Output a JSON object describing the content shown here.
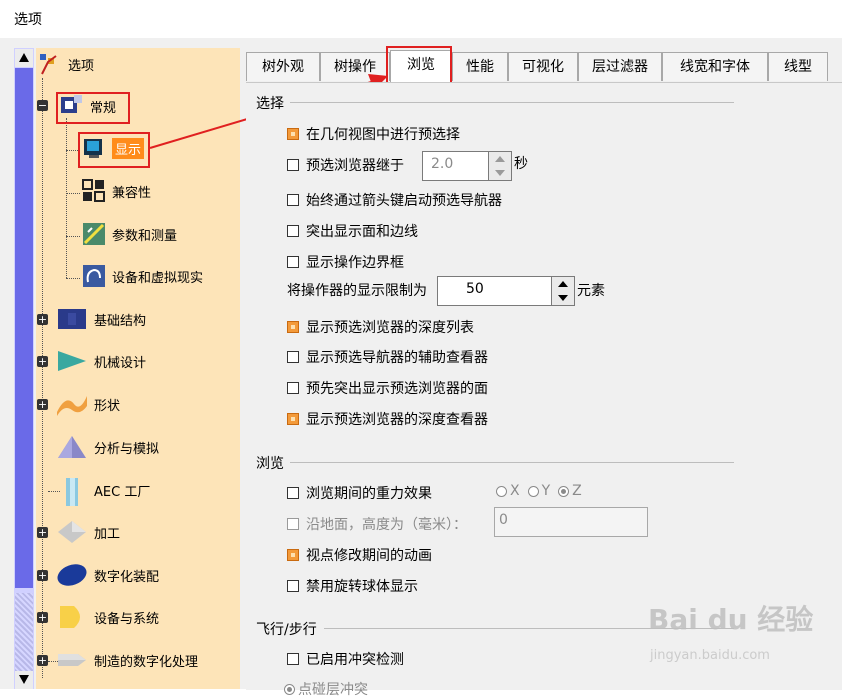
{
  "window": {
    "title": "选项"
  },
  "tree": {
    "root": "选项",
    "items": [
      {
        "label": "常规",
        "icon": "general-icon"
      },
      {
        "label": "显示",
        "icon": "display-icon",
        "selected": true
      },
      {
        "label": "兼容性",
        "icon": "compatibility-icon"
      },
      {
        "label": "参数和测量",
        "icon": "parameters-icon"
      },
      {
        "label": "设备和虚拟现实",
        "icon": "device-vr-icon"
      },
      {
        "label": "基础结构",
        "icon": "infrastructure-icon"
      },
      {
        "label": "机械设计",
        "icon": "mechanical-design-icon"
      },
      {
        "label": "形状",
        "icon": "shape-icon"
      },
      {
        "label": "分析与模拟",
        "icon": "analysis-icon"
      },
      {
        "label": "AEC 工厂",
        "icon": "aec-plant-icon"
      },
      {
        "label": "加工",
        "icon": "machining-icon"
      },
      {
        "label": "数字化装配",
        "icon": "digital-mockup-icon"
      },
      {
        "label": "设备与系统",
        "icon": "equipment-systems-icon"
      },
      {
        "label": "制造的数字化处理",
        "icon": "digital-manufacturing-icon"
      }
    ]
  },
  "tabs": [
    {
      "label": "树外观"
    },
    {
      "label": "树操作"
    },
    {
      "label": "浏览",
      "active": true
    },
    {
      "label": "性能"
    },
    {
      "label": "可视化"
    },
    {
      "label": "层过滤器"
    },
    {
      "label": "线宽和字体"
    },
    {
      "label": "线型"
    }
  ],
  "selection": {
    "heading": "选择",
    "preselect_geometry": "在几何视图中进行预选择",
    "preselect_navigator_label": "预选浏览器继于",
    "preselect_navigator_value": "2.0",
    "preselect_navigator_unit": "秒",
    "arrow_keys_navigator": "始终通过箭头键启动预选导航器",
    "highlight_faces_edges": "突出显示面和边线",
    "show_manipulator_bbox": "显示操作边界框",
    "manipulator_limit_label": "将操作器的显示限制为",
    "manipulator_limit_value": "50",
    "manipulator_limit_unit": "元素",
    "show_depth_list": "显示预选浏览器的深度列表",
    "show_aux_viewer": "显示预选导航器的辅助查看器",
    "prehighlight_faces": "预先突出显示预选浏览器的面",
    "show_depth_viewer": "显示预选浏览器的深度查看器"
  },
  "navigation": {
    "heading": "浏览",
    "gravity_effect": "浏览期间的重力效果",
    "axis_x": "X",
    "axis_y": "Y",
    "axis_z": "Z",
    "along_ground_label": "沿地面，高度为（毫米）：",
    "along_ground_value": "0",
    "animation": "视点修改期间的动画",
    "disable_trackball": "禁用旋转球体显示"
  },
  "fly_walk": {
    "heading": "飞行/步行",
    "collision_detection": "已启用冲突检测",
    "partial_option": "点碰层冲突"
  },
  "watermark": {
    "brand": "Bai du 经验",
    "url": "jingyan.baidu.com"
  },
  "colors": {
    "tree_bg": "#fde4b8",
    "checked": "#f39a3a",
    "highlight": "#e02020",
    "selected_bg": "#ff8c1a"
  }
}
